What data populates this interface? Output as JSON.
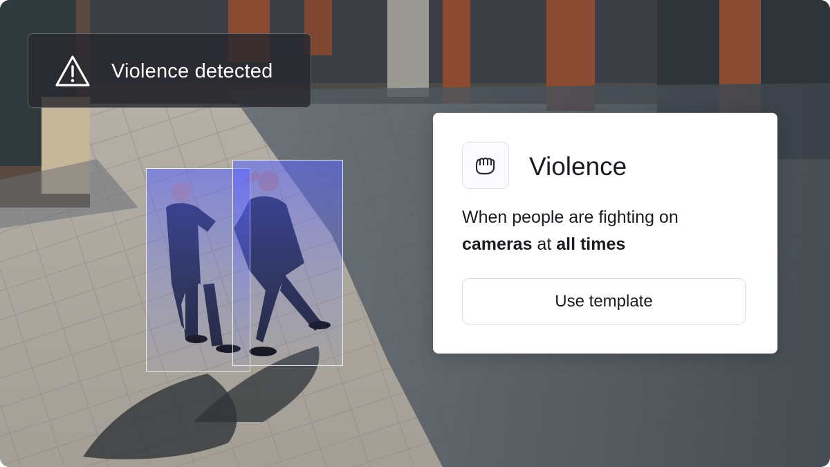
{
  "alert": {
    "icon": "warning-triangle-icon",
    "text": "Violence detected"
  },
  "detections": [
    {
      "label": "person"
    },
    {
      "label": "person"
    }
  ],
  "card": {
    "icon": "fist-icon",
    "title": "Violence",
    "description": {
      "part1": "When people are fighting on ",
      "bold1": "cameras",
      "part2": " at ",
      "bold2": "all times"
    },
    "button_label": "Use template"
  },
  "colors": {
    "detection_fill": "#5a64ff",
    "alert_bg": "#28282e",
    "card_bg": "#ffffff"
  }
}
